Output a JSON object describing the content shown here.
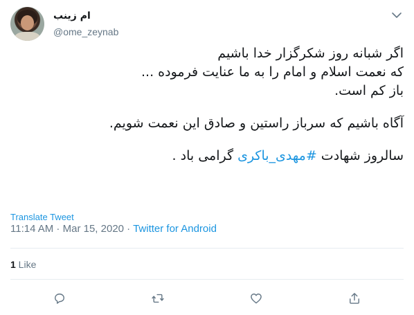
{
  "author": {
    "display_name": "ام زینب",
    "handle": "@ome_zeynab"
  },
  "tweet": {
    "lines": [
      "اگر شبانه روز شکرگزار خدا باشیم",
      "که نعمت اسلام و امام را به ما عنایت فرموده ...",
      "باز کم است.",
      "آگاه باشیم که سرباز راستین و صادق این نعمت شویم."
    ],
    "last_line_before": "سالروز شهادت ",
    "hashtag": "#مهدی_باکری",
    "last_line_after": " گرامی باد ."
  },
  "translate_label": "Translate Tweet",
  "meta": {
    "time": "11:14 AM",
    "separator": " · ",
    "date": "Mar 15, 2020",
    "source": "Twitter for Android"
  },
  "stats": {
    "likes_count": "1",
    "likes_label": " Like"
  },
  "icons": {
    "caret": "chevron-down-icon",
    "reply": "reply-icon",
    "retweet": "retweet-icon",
    "like": "heart-icon",
    "share": "share-icon"
  },
  "colors": {
    "link": "#1b95e0",
    "secondary_text": "#657786",
    "divider": "#e6ecf0"
  }
}
